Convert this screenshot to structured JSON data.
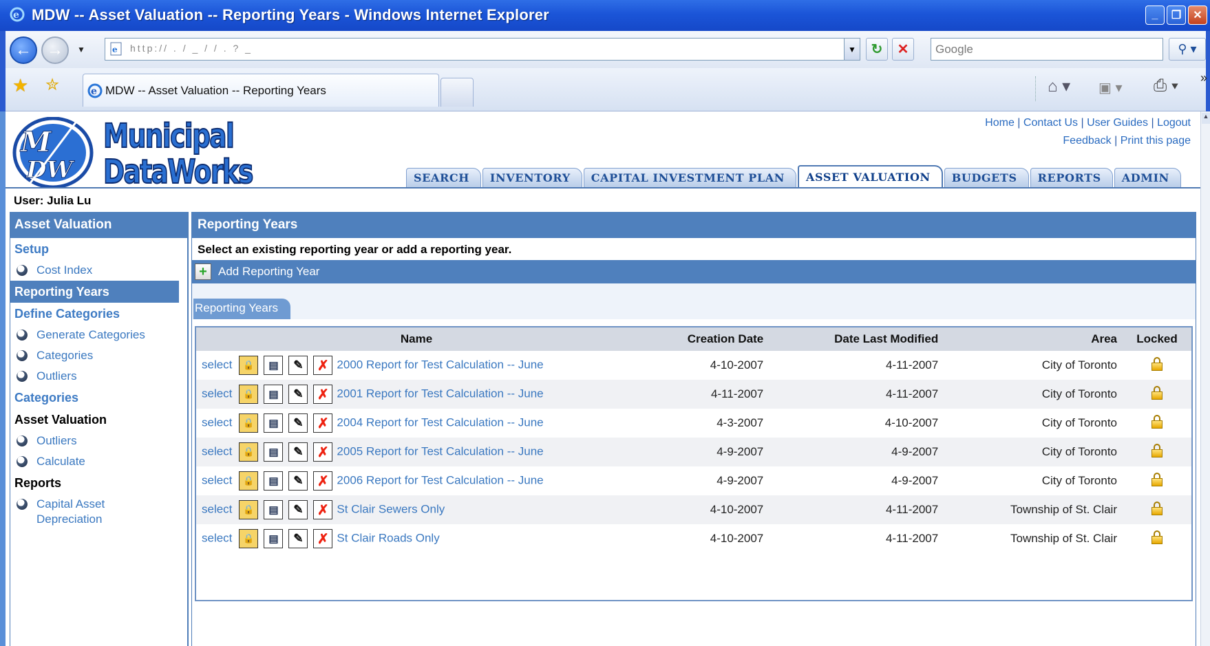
{
  "window": {
    "title": "MDW -- Asset Valuation -- Reporting Years - Windows Internet Explorer",
    "buttons": [
      "_",
      "❐",
      "✕"
    ]
  },
  "browser": {
    "address_url": "http://  .  /   _   /   /   .   ?   _",
    "search_placeholder": "Google",
    "tab_label": "MDW -- Asset Valuation -- Reporting Years"
  },
  "site": {
    "logo_line1": "Municipal",
    "logo_line2": "DataWorks",
    "logo_initials": "MDW",
    "top_links": {
      "home": "Home",
      "contact": "Contact Us",
      "guides": "User Guides",
      "logout": "Logout",
      "feedback": "Feedback",
      "print": "Print this page"
    },
    "tabs": [
      "SEARCH",
      "INVENTORY",
      "CAPITAL INVESTMENT PLAN",
      "ASSET VALUATION",
      "BUDGETS",
      "REPORTS",
      "ADMIN"
    ],
    "active_tab": "ASSET VALUATION",
    "user": "User: Julia Lu"
  },
  "sidebar": {
    "title": "Asset Valuation",
    "setup": "Setup",
    "cost_index": "Cost Index",
    "reporting_years": "Reporting Years",
    "define_categories": "Define Categories",
    "generate_categories": "Generate Categories",
    "categories_item": "Categories",
    "outliers_1": "Outliers",
    "categories": "Categories",
    "asset_valuation": "Asset Valuation",
    "outliers_2": "Outliers",
    "calculate": "Calculate",
    "reports": "Reports",
    "cap_asset_dep_1": "Capital Asset",
    "cap_asset_dep_2": "Depreciation"
  },
  "main": {
    "title": "Reporting Years",
    "instructions": "Select an existing reporting year or add a reporting year.",
    "add_label": "Add Reporting Year",
    "section_tab": "Reporting Years",
    "columns": {
      "name": "Name",
      "creation": "Creation Date",
      "modified": "Date Last Modified",
      "area": "Area",
      "locked": "Locked"
    },
    "select_label": "select",
    "rows": [
      {
        "name": "2000 Report for Test Calculation -- June",
        "created": "4-10-2007",
        "modified": "4-11-2007",
        "area": "City of Toronto"
      },
      {
        "name": "2001 Report for Test Calculation -- June",
        "created": "4-11-2007",
        "modified": "4-11-2007",
        "area": "City of Toronto"
      },
      {
        "name": "2004 Report for Test Calculation -- June",
        "created": "4-3-2007",
        "modified": "4-10-2007",
        "area": "City of Toronto"
      },
      {
        "name": "2005 Report for Test Calculation -- June",
        "created": "4-9-2007",
        "modified": "4-9-2007",
        "area": "City of Toronto"
      },
      {
        "name": "2006 Report for Test Calculation -- June",
        "created": "4-9-2007",
        "modified": "4-9-2007",
        "area": "City of Toronto"
      },
      {
        "name": "St Clair Sewers Only",
        "created": "4-10-2007",
        "modified": "4-11-2007",
        "area": "Township of St. Clair"
      },
      {
        "name": "St Clair Roads Only",
        "created": "4-10-2007",
        "modified": "4-11-2007",
        "area": "Township of St. Clair"
      }
    ]
  },
  "colors": {
    "titlebar": "#1b55d8",
    "header_blue": "#4f80bd",
    "link_blue": "#3a78c0"
  },
  "icons": {
    "row_actions": [
      "lock-icon",
      "copy-icon",
      "edit-icon",
      "delete-icon"
    ],
    "locked_column": "padlock-icon"
  }
}
